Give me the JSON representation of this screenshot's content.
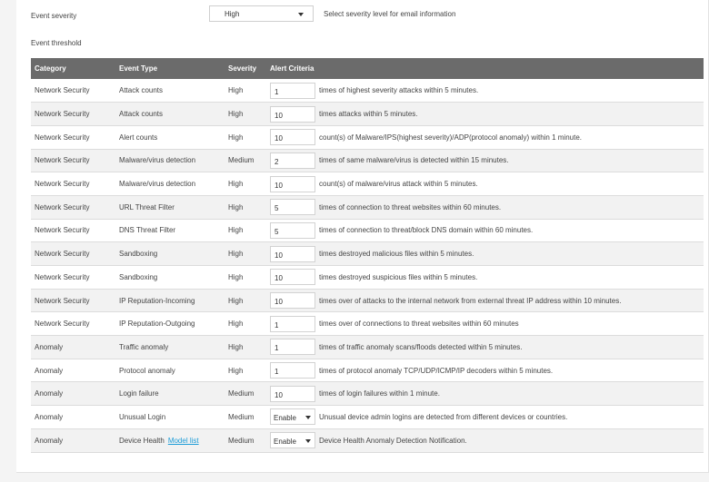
{
  "event_severity": {
    "label": "Event severity",
    "selected": "High",
    "hint": "Select severity level for email information"
  },
  "event_threshold": {
    "label": "Event threshold"
  },
  "table": {
    "columns": [
      "Category",
      "Event Type",
      "Severity",
      "Alert Criteria"
    ],
    "rows": [
      {
        "category": "Network Security",
        "event_type": "Attack counts",
        "severity": "High",
        "control": "input",
        "value": "1",
        "criteria": "times of highest severity attacks within 5 minutes."
      },
      {
        "category": "Network Security",
        "event_type": "Attack counts",
        "severity": "High",
        "control": "input",
        "value": "10",
        "criteria": "times attacks within 5 minutes."
      },
      {
        "category": "Network Security",
        "event_type": "Alert counts",
        "severity": "High",
        "control": "input",
        "value": "10",
        "criteria": "count(s) of Malware/IPS(highest severity)/ADP(protocol anomaly) within 1 minute."
      },
      {
        "category": "Network Security",
        "event_type": "Malware/virus detection",
        "severity": "Medium",
        "control": "input",
        "value": "2",
        "criteria": "times of same malware/virus is detected within 15 minutes."
      },
      {
        "category": "Network Security",
        "event_type": "Malware/virus detection",
        "severity": "High",
        "control": "input",
        "value": "10",
        "criteria": "count(s) of malware/virus attack within 5 minutes."
      },
      {
        "category": "Network Security",
        "event_type": "URL Threat Filter",
        "severity": "High",
        "control": "input",
        "value": "5",
        "criteria": "times of connection to threat websites within 60 minutes."
      },
      {
        "category": "Network Security",
        "event_type": "DNS Threat Filter",
        "severity": "High",
        "control": "input",
        "value": "5",
        "criteria": "times of connection to threat/block DNS domain within 60 minutes."
      },
      {
        "category": "Network Security",
        "event_type": "Sandboxing",
        "severity": "High",
        "control": "input",
        "value": "10",
        "criteria": "times destroyed malicious files within 5 minutes."
      },
      {
        "category": "Network Security",
        "event_type": "Sandboxing",
        "severity": "High",
        "control": "input",
        "value": "10",
        "criteria": "times destroyed suspicious files within 5 minutes."
      },
      {
        "category": "Network Security",
        "event_type": "IP Reputation-Incoming",
        "severity": "High",
        "control": "input",
        "value": "10",
        "criteria": "times over of attacks to the internal network from external threat IP address within 10 minutes."
      },
      {
        "category": "Network Security",
        "event_type": "IP Reputation-Outgoing",
        "severity": "High",
        "control": "input",
        "value": "1",
        "criteria": "times over of connections to threat websites within 60 minutes"
      },
      {
        "category": "Anomaly",
        "event_type": "Traffic anomaly",
        "severity": "High",
        "control": "input",
        "value": "1",
        "criteria": "times of traffic anomaly scans/floods detected within 5 minutes."
      },
      {
        "category": "Anomaly",
        "event_type": "Protocol anomaly",
        "severity": "High",
        "control": "input",
        "value": "1",
        "criteria": "times of protocol anomaly TCP/UDP/ICMP/IP decoders within 5 minutes."
      },
      {
        "category": "Anomaly",
        "event_type": "Login failure",
        "severity": "Medium",
        "control": "input",
        "value": "10",
        "criteria": "times of login failures within 1 minute."
      },
      {
        "category": "Anomaly",
        "event_type": "Unusual Login",
        "severity": "Medium",
        "control": "select",
        "value": "Enable",
        "criteria": "Unusual device admin logins are detected from different devices or countries."
      },
      {
        "category": "Anomaly",
        "event_type": "Device Health",
        "link": "Model list",
        "severity": "Medium",
        "control": "select",
        "value": "Enable",
        "criteria": "Device Health Anomaly Detection Notification."
      }
    ]
  },
  "colors": {
    "header_bg": "#6b6b6b",
    "row_alt_bg": "#f2f2f2",
    "link": "#1a9bd7"
  },
  "icons": {
    "dropdown": "chevron-down-icon"
  }
}
